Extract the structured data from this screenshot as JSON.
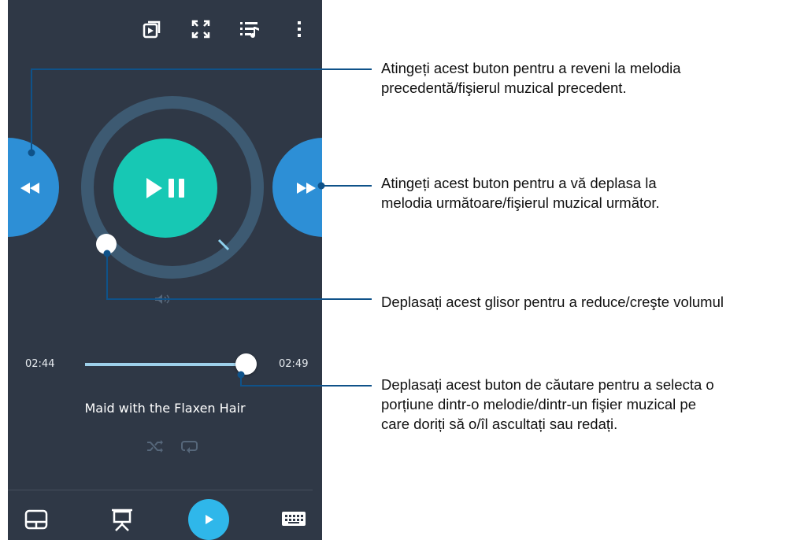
{
  "colors": {
    "phone_bg": "#2f3846",
    "play_button": "#17c8b4",
    "side_buttons": "#2d8fd6",
    "ring": "#3d5a72",
    "seek_track_filled": "#9ed0ea",
    "bottom_play": "#2fb7ea",
    "callout_line": "#0f5289"
  },
  "top_bar": {
    "icons": [
      "video-icon",
      "fullscreen-icon",
      "playlist-icon",
      "more-options-icon"
    ]
  },
  "player": {
    "track_title": "Maid with the Flaxen Hair",
    "elapsed_time": "02:44",
    "total_time": "02:49",
    "seek_progress_fraction": 0.965
  },
  "bottom_bar": {
    "icons": [
      "touchpad-icon",
      "presentation-icon",
      "play-icon",
      "keyboard-icon"
    ]
  },
  "callouts": {
    "previous": [
      "Atingeți acest buton pentru a reveni la melodia",
      "precedentă/fişierul muzical precedent."
    ],
    "next": [
      "Atingeți acest buton pentru a vă deplasa la",
      "melodia următoare/fişierul muzical următor."
    ],
    "volume": [
      "Deplasați acest glisor pentru a reduce/creşte volumul"
    ],
    "seek": [
      "Deplasați acest buton de căutare pentru a selecta o",
      "porțiune dintr-o melodie/dintr-un fişier muzical pe",
      "care doriți să o/îl ascultați sau redați."
    ]
  }
}
